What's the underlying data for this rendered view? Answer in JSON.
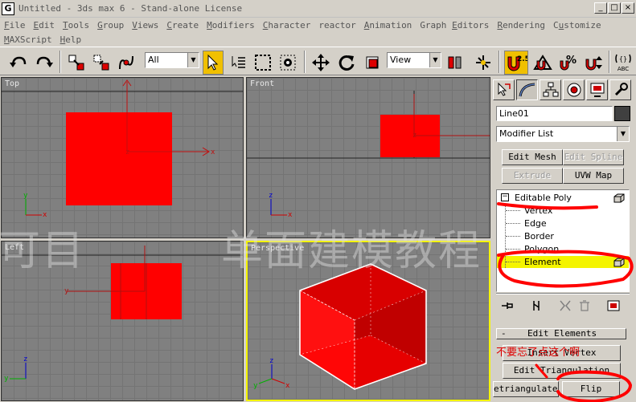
{
  "window": {
    "title": "Untitled - 3ds max 6 - Stand-alone License",
    "icon_letter": "G",
    "controls": [
      "_",
      "□",
      "×"
    ]
  },
  "menu": {
    "row1": [
      {
        "pre": "",
        "key": "F",
        "post": "ile"
      },
      {
        "pre": "",
        "key": "E",
        "post": "dit"
      },
      {
        "pre": "",
        "key": "T",
        "post": "ools"
      },
      {
        "pre": "",
        "key": "G",
        "post": "roup"
      },
      {
        "pre": "",
        "key": "V",
        "post": "iews"
      },
      {
        "pre": "",
        "key": "C",
        "post": "reate"
      },
      {
        "pre": "",
        "key": "M",
        "post": "odifiers"
      },
      {
        "pre": "",
        "key": "C",
        "post": "haracter"
      },
      {
        "pre": "",
        "key": "",
        "post": "reactor"
      },
      {
        "pre": "",
        "key": "A",
        "post": "nimation"
      },
      {
        "pre": "Graph ",
        "key": "E",
        "post": "ditors"
      },
      {
        "pre": "",
        "key": "R",
        "post": "endering"
      },
      {
        "pre": "C",
        "key": "u",
        "post": "stomize"
      }
    ],
    "row2": [
      {
        "pre": "",
        "key": "M",
        "post": "AXScript"
      },
      {
        "pre": "",
        "key": "H",
        "post": "elp"
      }
    ]
  },
  "toolbar": {
    "selection_filter": "All",
    "reference_coord": "View",
    "snap_label": "2.5",
    "percent_snap": "%",
    "abc_label": "ABC"
  },
  "viewports": {
    "top": {
      "label": "Top",
      "axis_x": "x",
      "axis_y": "y",
      "axis_z": "z"
    },
    "front": {
      "label": "Front",
      "axis_x": "x",
      "axis_z": "z"
    },
    "left": {
      "label": "Left",
      "axis_y": "y",
      "axis_z": "z"
    },
    "perspective": {
      "label": "Perspective",
      "axis_x": "x",
      "axis_y": "y",
      "axis_z": "z"
    }
  },
  "watermark": {
    "left": "可目",
    "right": "单面建模教程"
  },
  "command_panel": {
    "object_name": "Line01",
    "modifier_list": "Modifier List",
    "buttons": {
      "edit_mesh": "Edit Mesh",
      "edit_spline": "Edit Spline",
      "extrude": "Extrude",
      "uvw_map": "UVW Map"
    },
    "stack": {
      "root": "Editable Poly",
      "expander": "−",
      "items": [
        "Vertex",
        "Edge",
        "Border",
        "Polygon",
        "Element"
      ],
      "selected": "Element"
    },
    "rollout": {
      "title": "Edit Elements",
      "toggle": "-",
      "insert_vertex": "Insert Vertex",
      "edit_triangulation": "Edit Triangulation",
      "retriangulate": "etriangulate",
      "flip": "Flip"
    },
    "annotation": "不要忘了点这个啊"
  },
  "colors": {
    "object_red": "#ff0000",
    "selection_yellow": "#f4f400",
    "annotation_red": "#e00000",
    "ui_gray": "#d4d0c8",
    "viewport_gray": "#808080"
  }
}
